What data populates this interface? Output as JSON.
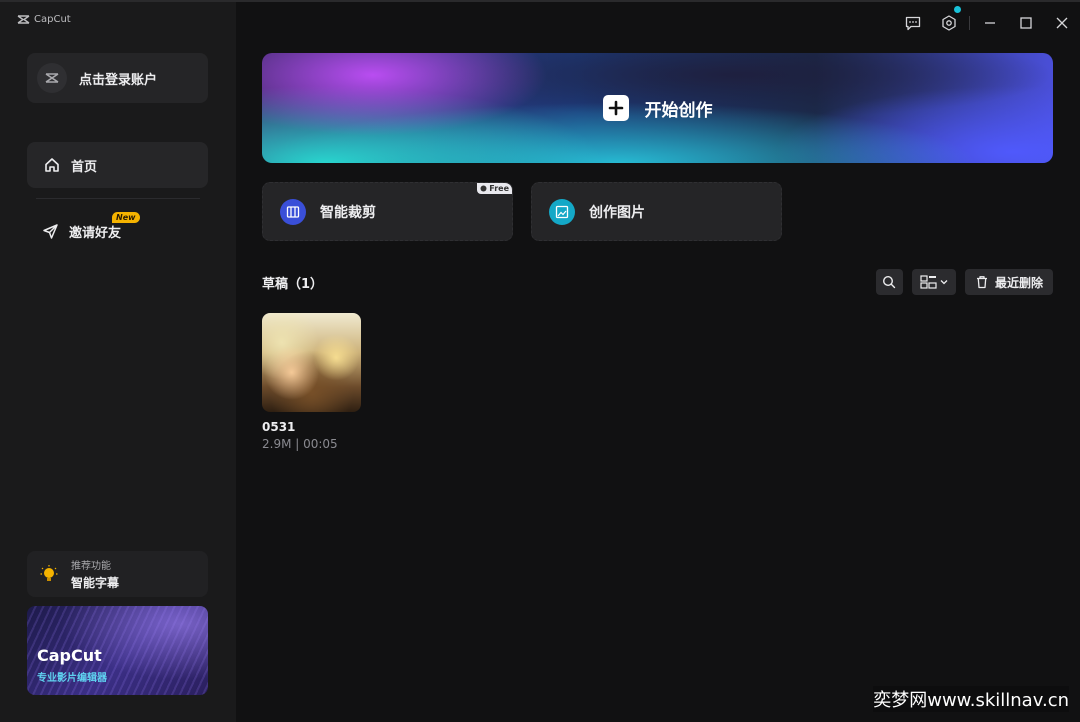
{
  "app": {
    "logo_text": "CapCut"
  },
  "sidebar": {
    "login_label": "点击登录账户",
    "nav": [
      {
        "label": "首页",
        "icon": "home-icon",
        "active": true
      },
      {
        "label": "邀请好友",
        "icon": "send-icon",
        "badge": "New"
      }
    ],
    "feature": {
      "caption": "推荐功能",
      "title": "智能字幕",
      "icon": "lightbulb-icon"
    },
    "promo": {
      "brand": "CapCut",
      "subtitle": "专业影片编辑器"
    }
  },
  "window_controls": [
    "feedback-icon",
    "settings-icon",
    "minimize-icon",
    "maximize-icon",
    "close-icon"
  ],
  "hero": {
    "label": "开始创作",
    "icon": "plus-icon"
  },
  "tools": [
    {
      "label": "智能裁剪",
      "badge": "Free",
      "icon": "crop-icon",
      "color": "#3a4fd8"
    },
    {
      "label": "创作图片",
      "icon": "image-icon",
      "color": "#14a8c7"
    }
  ],
  "drafts": {
    "title": "草稿（1）",
    "recent_delete_label": "最近删除",
    "items": [
      {
        "name": "0531",
        "meta": "2.9M | 00:05"
      }
    ]
  },
  "watermark": "奕梦网www.skillnav.cn"
}
